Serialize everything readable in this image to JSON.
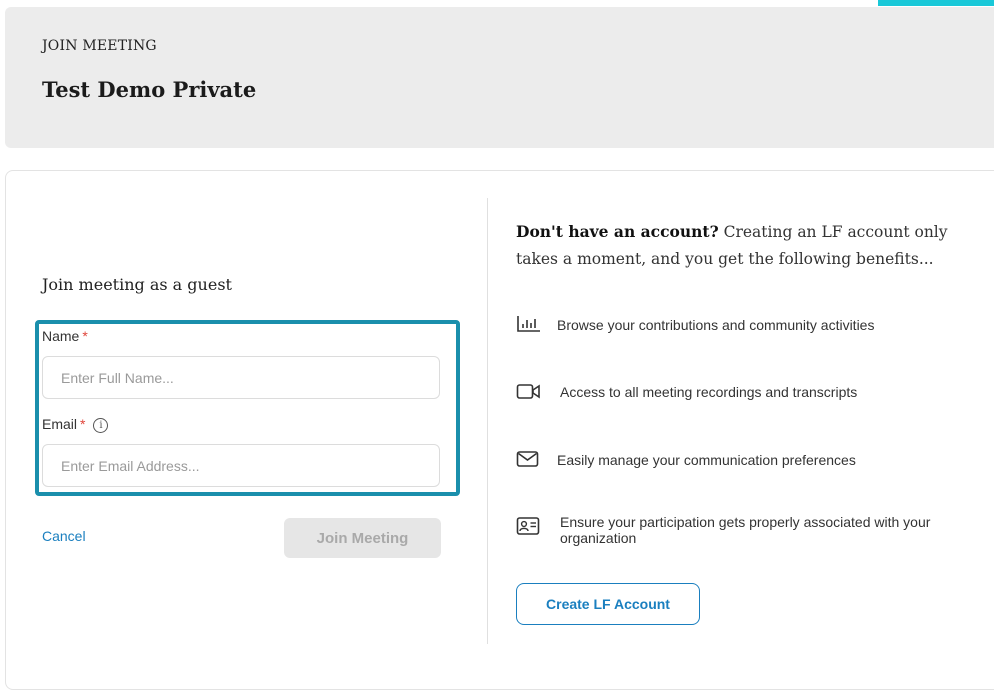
{
  "header": {
    "eyebrow": "JOIN MEETING",
    "title": "Test Demo Private"
  },
  "guest_form": {
    "heading": "Join meeting as a guest",
    "name_label": "Name",
    "name_placeholder": "Enter Full Name...",
    "name_value": "",
    "email_label": "Email",
    "email_placeholder": "Enter Email Address...",
    "email_value": "",
    "required_marker": "*",
    "info_icon": "info-icon",
    "cancel_label": "Cancel",
    "join_label": "Join Meeting"
  },
  "promo": {
    "lead_bold": "Don't have an account?",
    "lead_text": " Creating an LF account only takes a moment, and you get the following benefits...",
    "benefits": [
      {
        "icon": "bar-chart-icon",
        "text": "Browse your contributions and community activities"
      },
      {
        "icon": "video-camera-icon",
        "text": "Access to all meeting recordings and transcripts"
      },
      {
        "icon": "envelope-icon",
        "text": "Easily manage your communication preferences"
      },
      {
        "icon": "id-card-icon",
        "text": "Ensure your participation gets properly associated with your organization"
      }
    ],
    "create_label": "Create LF Account"
  },
  "colors": {
    "accent": "#1a8fac",
    "link": "#1a7fbf",
    "required": "#e0443a",
    "corner_accent": "#19c8d8"
  }
}
